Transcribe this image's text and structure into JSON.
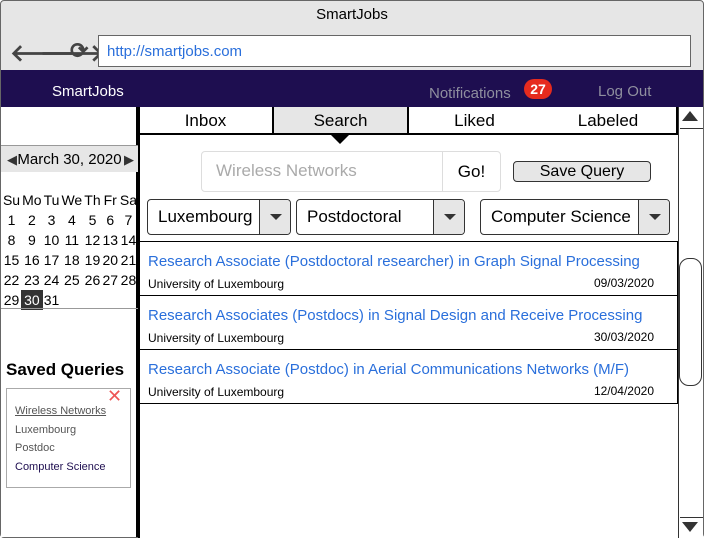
{
  "browser": {
    "title": "SmartJobs",
    "url": "http://smartjobs.com",
    "icons": [
      "back-arrow-icon",
      "forward-arrow-icon",
      "reload-icon"
    ]
  },
  "nav": {
    "brand": "SmartJobs",
    "notifications": "Notifications",
    "badge": "27",
    "logout": "Log Out"
  },
  "calendar": {
    "month": "March 30, 2020",
    "weekdays": [
      "Su",
      "Mo",
      "Tu",
      "We",
      "Th",
      "Fr",
      "Sa"
    ],
    "selected": "30",
    "weeks": [
      [
        "1",
        "2",
        "3",
        "4",
        "5",
        "6",
        "7"
      ],
      [
        "8",
        "9",
        "10",
        "11",
        "12",
        "13",
        "14"
      ],
      [
        "15",
        "16",
        "17",
        "18",
        "19",
        "20",
        "21"
      ],
      [
        "22",
        "23",
        "24",
        "25",
        "26",
        "27",
        "28"
      ],
      [
        "29",
        "30",
        "31",
        "",
        "",
        "",
        ""
      ]
    ]
  },
  "saved": {
    "title": "Saved Queries",
    "items": [
      "Wireless Networks",
      "Luxembourg",
      "Postdoc",
      "Computer Science"
    ]
  },
  "tabs": [
    "Inbox",
    "Search",
    "Liked",
    "Labeled"
  ],
  "active_tab": "Search",
  "search": {
    "placeholder": "Wireless Networks",
    "go": "Go!",
    "save": "Save Query"
  },
  "filters": [
    "Luxembourg",
    "Postdoctoral",
    "Computer Science"
  ],
  "results": [
    {
      "title": "Research Associate (Postdoctoral researcher) in Graph Signal Processing",
      "org": "University of Luxembourg",
      "date": "09/03/2020"
    },
    {
      "title": "Research Associates (Postdocs) in Signal Design and Receive Processing",
      "org": "University of Luxembourg",
      "date": "30/03/2020"
    },
    {
      "title": "Research Associate (Postdoc) in Aerial Communications Networks (M/F)",
      "org": "University of Luxembourg",
      "date": "12/04/2020"
    }
  ],
  "colors": {
    "navbar": "#1e0e50",
    "link": "#2a6fdb",
    "badge": "#e62b1e"
  }
}
